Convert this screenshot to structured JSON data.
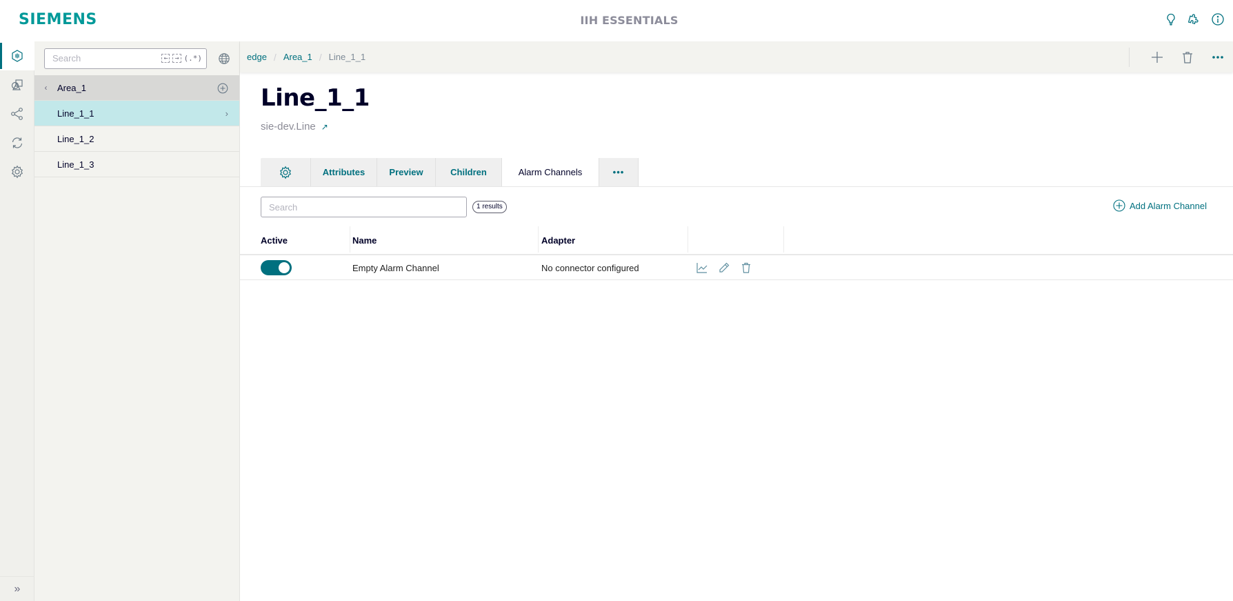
{
  "header": {
    "logo": "SIEMENS",
    "app_title": "IIH ESSENTIALS",
    "icons": [
      "lightbulb-icon",
      "puzzle-icon",
      "info-icon"
    ]
  },
  "rail": {
    "items": [
      {
        "name": "asset-model-icon",
        "active": true
      },
      {
        "name": "shapes-icon",
        "active": false
      },
      {
        "name": "share-icon",
        "active": false
      },
      {
        "name": "sync-icon",
        "active": false
      },
      {
        "name": "settings-icon",
        "active": false
      }
    ],
    "expand_label": "»"
  },
  "tree": {
    "search_placeholder": "Search",
    "search_buttons": {
      "prev": "←",
      "next": "→",
      "regex": "(.*)"
    },
    "parent": {
      "label": "Area_1"
    },
    "children": [
      {
        "label": "Line_1_1",
        "selected": true
      },
      {
        "label": "Line_1_2",
        "selected": false
      },
      {
        "label": "Line_1_3",
        "selected": false
      }
    ]
  },
  "breadcrumb": {
    "items": [
      "edge",
      "Area_1",
      "Line_1_1"
    ],
    "separator": "/"
  },
  "page": {
    "title": "Line_1_1",
    "type": "sie-dev.Line",
    "type_link_icon": "↗"
  },
  "tabs": [
    {
      "label": "",
      "icon": "gear-icon",
      "active": false
    },
    {
      "label": "Attributes",
      "active": false
    },
    {
      "label": "Preview",
      "active": false
    },
    {
      "label": "Children",
      "active": false
    },
    {
      "label": "Alarm Channels",
      "active": true
    },
    {
      "label": "•••",
      "active": false
    }
  ],
  "alarm_channels": {
    "search_placeholder": "Search",
    "results_badge": "1 results",
    "add_label": "Add Alarm Channel",
    "columns": [
      "Active",
      "Name",
      "Adapter",
      ""
    ],
    "rows": [
      {
        "active": true,
        "name": "Empty Alarm Channel",
        "adapter": "No connector configured"
      }
    ]
  },
  "colors": {
    "brand": "#009999",
    "accent": "#00707f",
    "selected_row": "#c2e8ea"
  }
}
